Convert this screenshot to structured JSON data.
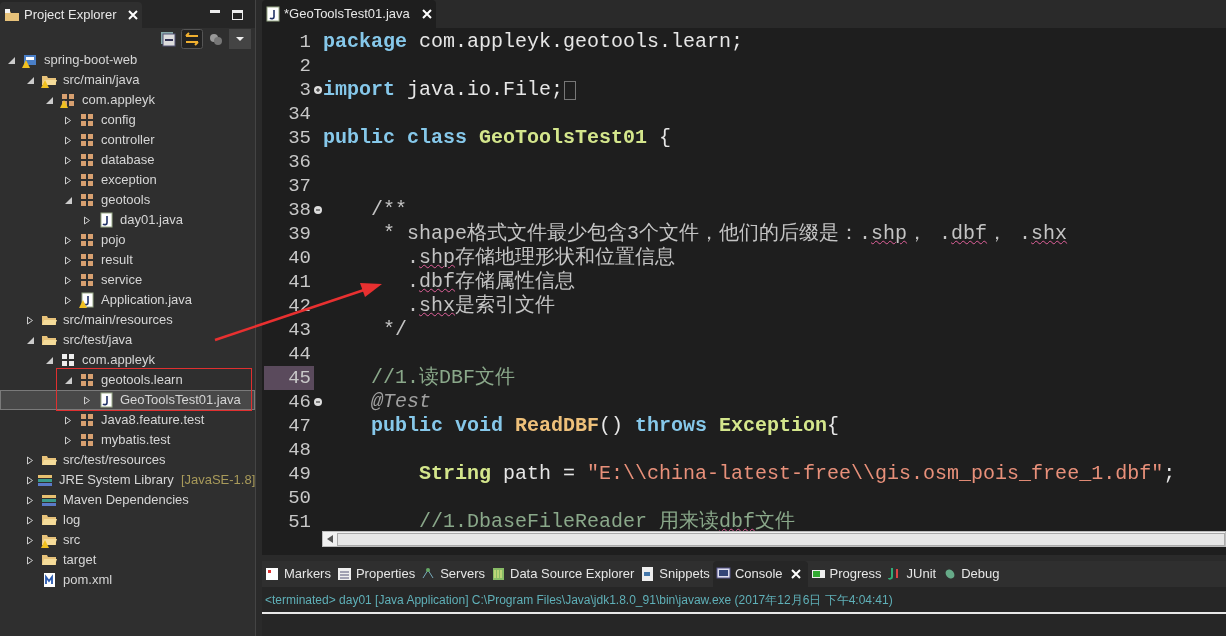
{
  "explorer": {
    "title": "Project Explorer",
    "tree": [
      {
        "label": "spring-boot-web",
        "kind": "project",
        "warning": true,
        "expanded": true,
        "selected": false,
        "children": [
          {
            "label": "src/main/java",
            "kind": "source-folder",
            "warning": true,
            "expanded": true,
            "selected": false,
            "children": [
              {
                "label": "com.appleyk",
                "kind": "package",
                "warning": true,
                "expanded": true,
                "selected": false,
                "children": [
                  {
                    "label": "config",
                    "kind": "package",
                    "expanded": false,
                    "selected": false
                  },
                  {
                    "label": "controller",
                    "kind": "package",
                    "expanded": false,
                    "selected": false
                  },
                  {
                    "label": "database",
                    "kind": "package",
                    "expanded": false,
                    "selected": false
                  },
                  {
                    "label": "exception",
                    "kind": "package",
                    "expanded": false,
                    "selected": false
                  },
                  {
                    "label": "geotools",
                    "kind": "package",
                    "expanded": true,
                    "selected": false,
                    "children": [
                      {
                        "label": "day01.java",
                        "kind": "java-file",
                        "expanded": false,
                        "selected": false
                      }
                    ]
                  },
                  {
                    "label": "pojo",
                    "kind": "package",
                    "expanded": false,
                    "selected": false
                  },
                  {
                    "label": "result",
                    "kind": "package",
                    "expanded": false,
                    "selected": false
                  },
                  {
                    "label": "service",
                    "kind": "package",
                    "expanded": false,
                    "selected": false
                  },
                  {
                    "label": "Application.java",
                    "kind": "java-file",
                    "warning": true,
                    "expanded": false,
                    "selected": false
                  }
                ]
              }
            ]
          },
          {
            "label": "src/main/resources",
            "kind": "source-folder",
            "expanded": false,
            "selected": false
          },
          {
            "label": "src/test/java",
            "kind": "source-folder",
            "expanded": true,
            "selected": false,
            "children": [
              {
                "label": "com.appleyk",
                "kind": "empty-package",
                "expanded": true,
                "selected": false,
                "children": [
                  {
                    "label": "geotools.learn",
                    "kind": "package",
                    "expanded": true,
                    "selected": false,
                    "children": [
                      {
                        "label": "GeoToolsTest01.java",
                        "kind": "java-file",
                        "expanded": false,
                        "selected": true
                      }
                    ]
                  },
                  {
                    "label": "Java8.feature.test",
                    "kind": "package",
                    "expanded": false,
                    "selected": false
                  },
                  {
                    "label": "mybatis.test",
                    "kind": "package",
                    "expanded": false,
                    "selected": false
                  }
                ]
              }
            ]
          },
          {
            "label": "src/test/resources",
            "kind": "source-folder",
            "expanded": false,
            "selected": false
          },
          {
            "label": "JRE System Library",
            "decoration": "[JavaSE-1.8]",
            "kind": "library",
            "expanded": false,
            "selected": false
          },
          {
            "label": "Maven Dependencies",
            "kind": "library",
            "expanded": false,
            "selected": false
          },
          {
            "label": "log",
            "kind": "folder",
            "expanded": false,
            "selected": false
          },
          {
            "label": "src",
            "kind": "folder",
            "warning": true,
            "expanded": false,
            "selected": false
          },
          {
            "label": "target",
            "kind": "folder",
            "expanded": false,
            "selected": false
          },
          {
            "label": "pom.xml",
            "kind": "xml-file",
            "selected": false
          }
        ]
      }
    ]
  },
  "editor": {
    "tab": {
      "label": "*GeoToolsTest01.java",
      "selected": true
    },
    "lines": [
      {
        "number": "1",
        "tokens": [
          {
            "text": "package",
            "kind": "kw"
          },
          {
            "text": " com.appleyk.geotools.learn;",
            "kind": "plain"
          }
        ]
      },
      {
        "number": "2"
      },
      {
        "number": "3",
        "folded": true,
        "tokens": [
          {
            "text": "import",
            "kind": "kw"
          },
          {
            "text": " java.io.File;",
            "kind": "plain"
          }
        ]
      },
      {
        "number": "34"
      },
      {
        "number": "35",
        "tokens": [
          {
            "text": "public class",
            "kind": "kw"
          },
          {
            "text": " GeoToolsTest01",
            "kind": "type"
          },
          {
            "text": " {",
            "kind": "plain"
          }
        ]
      },
      {
        "number": "36"
      },
      {
        "number": "37"
      },
      {
        "number": "38",
        "folded": false,
        "tokens": [
          {
            "text": "    /**",
            "kind": "doc"
          }
        ]
      },
      {
        "number": "39",
        "tokens": [
          {
            "text": "     * shape格式文件最少包含3个文件，他们的后缀是：.",
            "kind": "doc"
          },
          {
            "text": "shp",
            "kind": "doc",
            "misspelled": true
          },
          {
            "text": "， .",
            "kind": "doc"
          },
          {
            "text": "dbf",
            "kind": "doc",
            "misspelled": true
          },
          {
            "text": "， .",
            "kind": "doc"
          },
          {
            "text": "shx",
            "kind": "doc",
            "misspelled": true
          }
        ]
      },
      {
        "number": "40",
        "tokens": [
          {
            "text": "       .",
            "kind": "doc"
          },
          {
            "text": "shp",
            "kind": "doc",
            "misspelled": true
          },
          {
            "text": "存储地理形状和位置信息",
            "kind": "doc"
          }
        ]
      },
      {
        "number": "41",
        "tokens": [
          {
            "text": "       .",
            "kind": "doc"
          },
          {
            "text": "dbf",
            "kind": "doc",
            "misspelled": true
          },
          {
            "text": "存储属性信息",
            "kind": "doc"
          }
        ]
      },
      {
        "number": "42",
        "tokens": [
          {
            "text": "       .",
            "kind": "doc"
          },
          {
            "text": "shx",
            "kind": "doc",
            "misspelled": true
          },
          {
            "text": "是索引文件",
            "kind": "doc"
          }
        ]
      },
      {
        "number": "43",
        "tokens": [
          {
            "text": "     */",
            "kind": "doc"
          }
        ]
      },
      {
        "number": "44"
      },
      {
        "number": "45",
        "current": true,
        "tokens": [
          {
            "text": "    //1.读DBF文件",
            "kind": "comment"
          }
        ]
      },
      {
        "number": "46",
        "folded": false,
        "tokens": [
          {
            "text": "    @Test",
            "kind": "annot"
          }
        ]
      },
      {
        "number": "47",
        "tokens": [
          {
            "text": "    public void",
            "kind": "kw"
          },
          {
            "text": " ReadDBF",
            "kind": "method"
          },
          {
            "text": "() ",
            "kind": "plain"
          },
          {
            "text": "throws",
            "kind": "kw"
          },
          {
            "text": " Exception",
            "kind": "type"
          },
          {
            "text": "{",
            "kind": "plain"
          }
        ]
      },
      {
        "number": "48"
      },
      {
        "number": "49",
        "tokens": [
          {
            "text": "        String",
            "kind": "type"
          },
          {
            "text": " path = ",
            "kind": "plain"
          },
          {
            "text": "\"E:\\\\china-latest-free\\\\gis.osm_pois_free_1.dbf\"",
            "kind": "string"
          },
          {
            "text": ";",
            "kind": "plain"
          }
        ]
      },
      {
        "number": "50"
      },
      {
        "number": "51",
        "tokens": [
          {
            "text": "        //1.DbaseFileReader 用来读",
            "kind": "comment"
          },
          {
            "text": "dbf",
            "kind": "comment",
            "misspelled": true
          },
          {
            "text": "文件",
            "kind": "comment"
          }
        ]
      }
    ]
  },
  "bottom": {
    "tabs": [
      {
        "label": "Markers",
        "kind": "markers",
        "selected": false
      },
      {
        "label": "Properties",
        "kind": "properties",
        "selected": false
      },
      {
        "label": "Servers",
        "kind": "servers",
        "selected": false
      },
      {
        "label": "Data Source Explorer",
        "kind": "datasource",
        "selected": false
      },
      {
        "label": "Snippets",
        "kind": "snippets",
        "selected": false
      },
      {
        "label": "Console",
        "kind": "console",
        "selected": true
      },
      {
        "label": "Progress",
        "kind": "progress",
        "selected": false
      },
      {
        "label": "JUnit",
        "kind": "junit",
        "selected": false
      },
      {
        "label": "Debug",
        "kind": "debug",
        "selected": false
      }
    ],
    "console": "<terminated> day01 [Java Application] C:\\Program Files\\Java\\jdk1.8.0_91\\bin\\javaw.exe (2017年12月6日 下午4:04:41)"
  }
}
